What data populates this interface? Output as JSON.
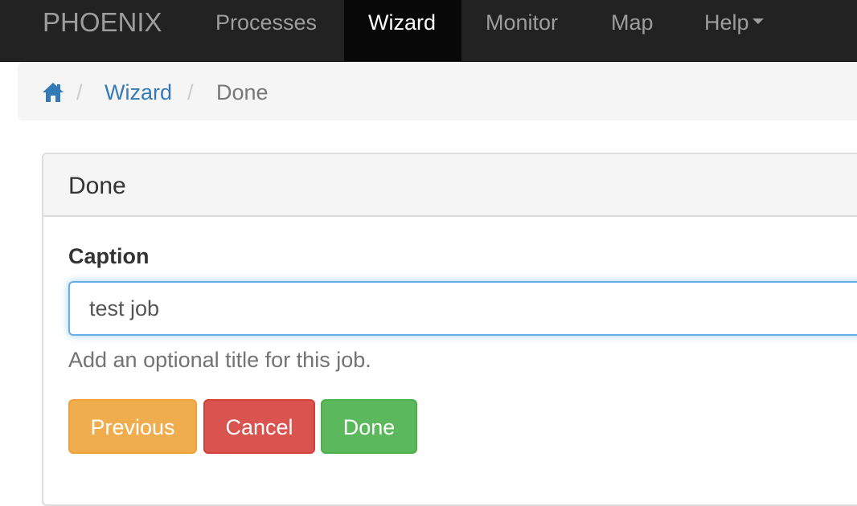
{
  "navbar": {
    "brand": "PHOENIX",
    "items": [
      {
        "label": "Processes"
      },
      {
        "label": "Wizard",
        "active": true
      },
      {
        "label": "Monitor"
      },
      {
        "label": "Map"
      },
      {
        "label": "Help"
      }
    ]
  },
  "breadcrumb": {
    "home_icon": "home-icon",
    "separator": "/",
    "items": [
      {
        "label": "Wizard"
      },
      {
        "label": "Done"
      }
    ]
  },
  "panel": {
    "title": "Done",
    "caption": {
      "label": "Caption",
      "value": "test job",
      "help": "Add an optional title for this job."
    },
    "buttons": {
      "previous": "Previous",
      "cancel": "Cancel",
      "done": "Done"
    }
  },
  "colors": {
    "navbar_bg": "#222222",
    "link": "#337ab7",
    "warning": "#f0ad4e",
    "danger": "#d9534f",
    "success": "#5cb85c"
  }
}
